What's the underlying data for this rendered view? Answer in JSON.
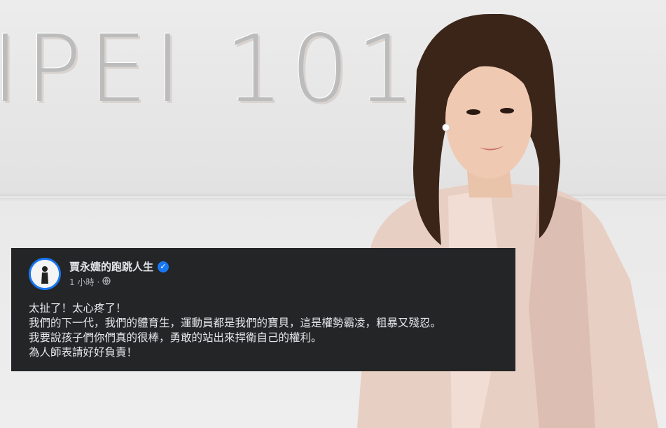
{
  "background": {
    "sign_text": "IPEI 101"
  },
  "post": {
    "author": "賈永婕的跑跳人生",
    "verified_icon": "verified-badge-icon",
    "timestamp": "1 小時",
    "separator": "·",
    "privacy_icon": "globe-icon",
    "lines": [
      "太扯了！太心疼了！",
      "我們的下一代，我們的體育生，運動員都是我們的寶貝，這是權勢霸凌，粗暴又殘忍。",
      "我要說孩子們你們真的很棒，勇敢的站出來捍衛自己的權利。",
      "為人師表請好好負責！"
    ]
  },
  "colors": {
    "post_background": "#242526",
    "post_text": "#e4e6eb",
    "secondary_text": "#b0b3b8",
    "accent": "#1877f2"
  }
}
